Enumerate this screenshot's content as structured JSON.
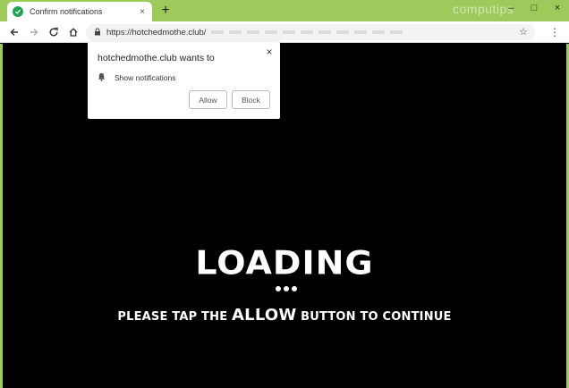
{
  "browser": {
    "tab_title": "Confirm notifications",
    "tab_close": "×",
    "new_tab": "+",
    "window_controls": [
      "–",
      "□",
      "×"
    ],
    "watermark": "computips",
    "url": "https://hotchedmothe.club/",
    "menu": "⋮",
    "star": "☆"
  },
  "popup": {
    "title": "hotchedmothe.club wants to",
    "close": "×",
    "permission_label": "Show notifications",
    "allow_label": "Allow",
    "block_label": "Block"
  },
  "page": {
    "loading_text": "LOADING",
    "instruction_part1": "PLEASE TAP THE ",
    "instruction_highlight": "ALLOW",
    "instruction_part2": " BUTTON TO CONTINUE"
  },
  "colors": {
    "accent": "#9ccb5b",
    "favicon": "#23a555",
    "page_bg": "#000000"
  }
}
